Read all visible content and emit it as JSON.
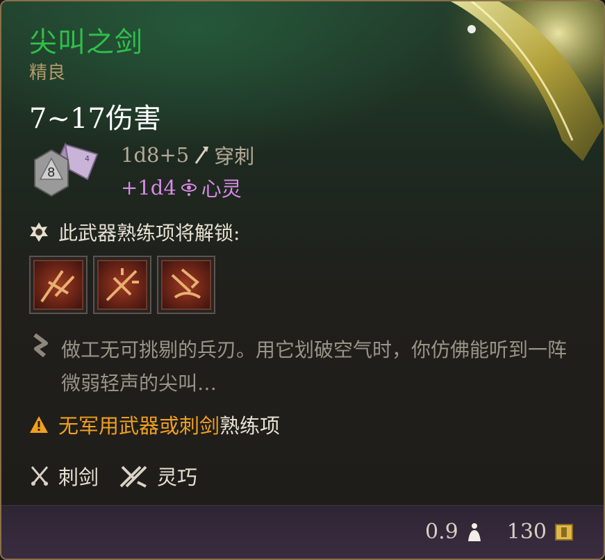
{
  "item": {
    "name": "尖叫之剑",
    "rarity": "精良",
    "damage_total": "7~17伤害"
  },
  "damage_lines": [
    {
      "dice": "1d8+5",
      "type": "穿刺",
      "icon": "piercing-arrow-icon"
    },
    {
      "dice": "+1d4",
      "type": "心灵",
      "icon": "psychic-eye-icon"
    }
  ],
  "die_label": "8",
  "proficiency": {
    "unlock_label": "此武器熟练项将解锁:",
    "actions": [
      {
        "icon": "weapon-action-slash-icon"
      },
      {
        "icon": "weapon-action-pierce-icon"
      },
      {
        "icon": "weapon-action-hamstring-icon"
      }
    ]
  },
  "description": "做工无可挑剔的兵刃。用它划破空气时，你仿佛能听到一阵微弱轻声的尖叫…",
  "warning": {
    "highlight": "无军用武器或刺剑",
    "rest": "熟练项"
  },
  "properties": [
    {
      "label": "刺剑",
      "icon": "rapier-crossed-icon"
    },
    {
      "label": "灵巧",
      "icon": "finesse-icon"
    }
  ],
  "footer": {
    "weight": "0.9",
    "value": "130",
    "weight_icon": "weight-icon",
    "gold_icon": "gold-coin-icon"
  },
  "colors": {
    "title": "#2fbf4a",
    "rarity": "#b39b6a",
    "psychic": "#d78ae6",
    "warning": "#f0a020"
  }
}
